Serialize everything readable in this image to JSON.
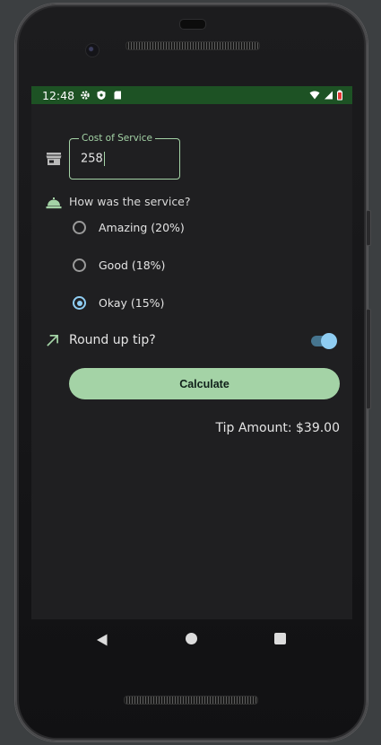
{
  "status_bar": {
    "time": "12:48",
    "icons": [
      "gear-icon",
      "shield-icon",
      "sd-card-icon",
      "wifi-icon",
      "signal-icon",
      "battery-icon"
    ],
    "background_color": "#1d5224"
  },
  "cost_field": {
    "label": "Cost of Service",
    "value": "258",
    "icon": "storefront-icon"
  },
  "service_question": {
    "text": "How was the service?",
    "icon": "room-service-bell-icon"
  },
  "tip_options": [
    {
      "label": "Amazing (20%)",
      "selected": false
    },
    {
      "label": "Good (18%)",
      "selected": false
    },
    {
      "label": "Okay (15%)",
      "selected": true
    }
  ],
  "round_up": {
    "label": "Round up tip?",
    "icon": "trending-up-icon",
    "enabled": true
  },
  "calculate_button": {
    "label": "Calculate"
  },
  "tip_result": {
    "text": "Tip Amount: $39.00"
  },
  "navigation": {
    "icons": [
      "back-icon",
      "home-icon",
      "recents-icon"
    ]
  },
  "colors": {
    "accent_green": "#a4d3a6",
    "accent_blue": "#8fcdf2",
    "screen_background": "#1f1f21"
  }
}
